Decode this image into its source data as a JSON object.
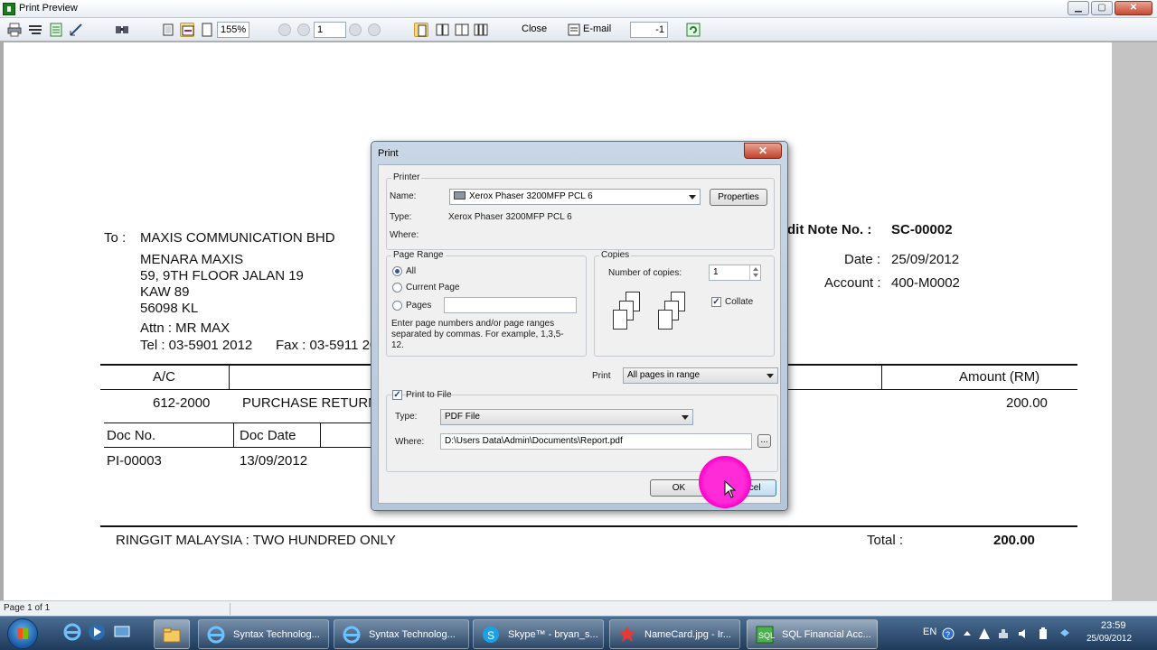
{
  "window": {
    "title": "Print Preview",
    "controls": {
      "minimize": "▁",
      "maximize": "▢",
      "close": "✕"
    }
  },
  "toolbar": {
    "zoom": "155%",
    "page": "1",
    "close_label": "Close",
    "email_label": "E-mail",
    "copies": "-1",
    "icons": [
      "print-icon",
      "print-setup-icon",
      "export-icon",
      "design-icon",
      "find-icon",
      "single-page-icon",
      "page-width-icon",
      "multi-page-icon",
      "first-page-icon",
      "prev-page-icon",
      "next-page-icon",
      "last-page-icon",
      "email-icon",
      "refresh-icon"
    ]
  },
  "document": {
    "to_label": "To :",
    "company": "MAXIS COMMUNICATION BHD",
    "address": [
      "MENARA MAXIS",
      "59, 9TH FLOOR JALAN 19",
      "KAW 89",
      "56098 KL"
    ],
    "attn": "Attn : MR MAX",
    "tel": "Tel : 03-5901 2012",
    "fax": "Fax : 03-5911 20",
    "credit_note_label": "dit Note No. :",
    "credit_note_no": "SC-00002",
    "date_label": "Date :",
    "date": "25/09/2012",
    "account_label": "Account :",
    "account": "400-M0002",
    "col_ac": "A/C",
    "col_amount": "Amount (RM)",
    "row_ac": "612-2000",
    "row_desc": "PURCHASE RETURNE",
    "row_amount": "200.00",
    "doc_no_header": "Doc No.",
    "doc_date_header": "Doc Date",
    "doc_no": "PI-00003",
    "doc_date": "13/09/2012",
    "words": "RINGGIT MALAYSIA : TWO HUNDRED ONLY",
    "total_label": "Total :",
    "total": "200.00"
  },
  "status": {
    "page_info": "Page 1 of 1"
  },
  "dialog": {
    "title": "Print",
    "close": "✕",
    "printer_group": "Printer",
    "name_label": "Name:",
    "printer_name": "Xerox Phaser 3200MFP PCL 6",
    "properties_button": "Properties",
    "type_label": "Type:",
    "type_value": "Xerox Phaser 3200MFP PCL 6",
    "where_label": "Where:",
    "page_range_group": "Page Range",
    "all_label": "All",
    "current_page_label": "Current Page",
    "pages_label": "Pages",
    "pages_help": "Enter page numbers and/or page ranges separated by commas.  For example, 1,3,5-12.",
    "copies_group": "Copies",
    "num_copies_label": "Number of copies:",
    "num_copies": "1",
    "collate_label": "Collate",
    "print_label": "Print",
    "print_range": "All pages in range",
    "print_to_file_label": "Print to File",
    "file_type_label": "Type:",
    "file_type": "PDF File",
    "file_where_label": "Where:",
    "file_path": "D:\\Users Data\\Admin\\Documents\\Report.pdf",
    "browse_button": "...",
    "ok_button": "OK",
    "cancel_button": "Cancel"
  },
  "taskbar": {
    "tasks": [
      {
        "label": "Syntax Technolog..."
      },
      {
        "label": "Syntax Technolog..."
      },
      {
        "label": "Skype™ - bryan_s..."
      },
      {
        "label": "NameCard.jpg - Ir..."
      },
      {
        "label": "SQL Financial Acc..."
      }
    ],
    "language": "EN",
    "time": "23:59",
    "date": "25/09/2012"
  }
}
